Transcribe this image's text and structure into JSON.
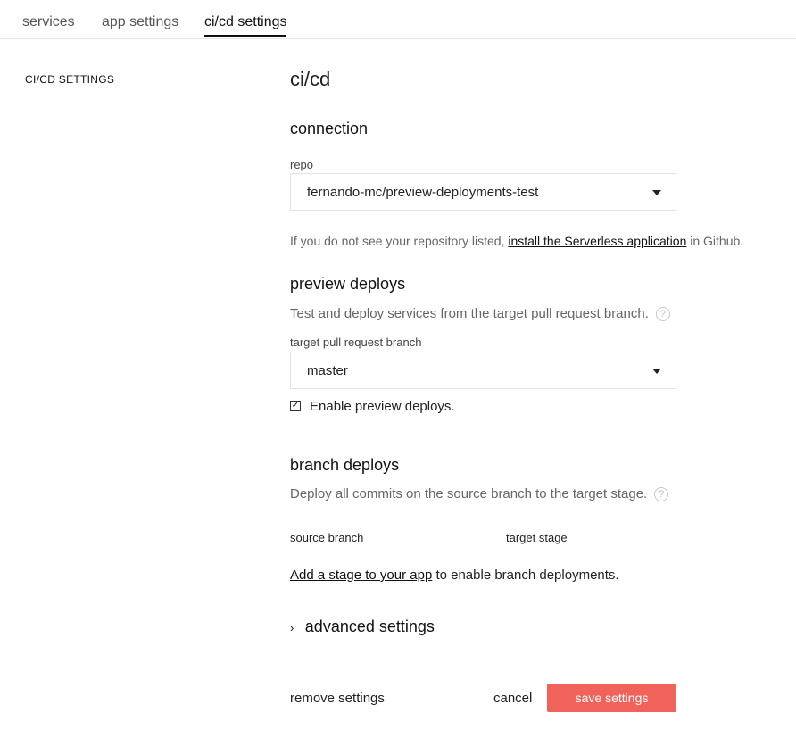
{
  "tabs": [
    {
      "label": "services"
    },
    {
      "label": "app settings"
    },
    {
      "label": "ci/cd settings"
    }
  ],
  "sidebar": {
    "title": "CI/CD SETTINGS"
  },
  "main": {
    "title": "ci/cd",
    "connection": {
      "heading": "connection",
      "repo_label": "repo",
      "repo_value": "fernando-mc/preview-deployments-test",
      "help_prefix": "If you do not see your repository listed, ",
      "help_link": "install the Serverless application",
      "help_suffix": " in Github."
    },
    "preview": {
      "heading": "preview deploys",
      "description": "Test and deploy services from the target pull request branch.",
      "help_icon": "?",
      "branch_label": "target pull request branch",
      "branch_value": "master",
      "enable_checked": true,
      "checkbox_mark": "✓",
      "enable_label": "Enable preview deploys."
    },
    "branch": {
      "heading": "branch deploys",
      "description": "Deploy all commits on the source branch to the target stage.",
      "help_icon": "?",
      "source_col": "source branch",
      "target_col": "target stage",
      "add_link": "Add a stage to your app",
      "add_suffix": " to enable branch deployments."
    },
    "advanced": {
      "chevron": "›",
      "label": "advanced settings"
    },
    "actions": {
      "remove": "remove settings",
      "cancel": "cancel",
      "save": "save settings"
    }
  },
  "colors": {
    "accent": "#f0625a",
    "border": "#e6e6e6"
  }
}
